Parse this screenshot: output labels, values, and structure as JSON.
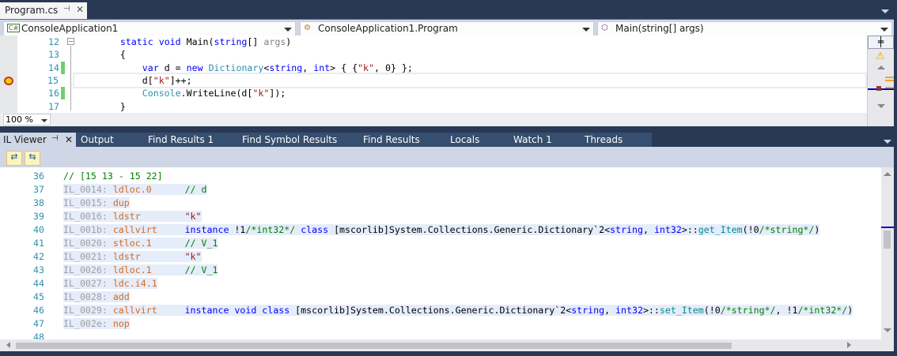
{
  "doc_tab": {
    "title": "Program.cs",
    "pin": "⊣",
    "close": "✕"
  },
  "nav": {
    "project": "ConsoleApplication1",
    "project_icon": "C#",
    "class": "ConsoleApplication1.Program",
    "member": "Main(string[] args)"
  },
  "editor": {
    "zoom": "100 %",
    "current_line": 15,
    "lines": [
      {
        "n": "12",
        "t": [
          [
            "        ",
            "tx"
          ],
          [
            "static",
            "kw"
          ],
          [
            " ",
            "tx"
          ],
          [
            "void",
            "kw"
          ],
          [
            " Main(",
            "tx"
          ],
          [
            "string",
            "kw"
          ],
          [
            "[] ",
            "tx"
          ],
          [
            "args",
            "gr"
          ],
          [
            ")",
            "tx"
          ]
        ]
      },
      {
        "n": "13",
        "t": [
          [
            "        {",
            "tx"
          ]
        ]
      },
      {
        "n": "14",
        "t": [
          [
            "            ",
            "tx"
          ],
          [
            "var",
            "kw"
          ],
          [
            " d = ",
            "tx"
          ],
          [
            "new",
            "kw"
          ],
          [
            " ",
            "tx"
          ],
          [
            "Dictionary",
            "ty"
          ],
          [
            "<",
            "tx"
          ],
          [
            "string",
            "kw"
          ],
          [
            ", ",
            "tx"
          ],
          [
            "int",
            "kw"
          ],
          [
            "> { {",
            "tx"
          ],
          [
            "\"k\"",
            "st"
          ],
          [
            ", 0} };",
            "tx"
          ]
        ]
      },
      {
        "n": "15",
        "t": [
          [
            "            d[",
            "tx"
          ],
          [
            "\"k\"",
            "st"
          ],
          [
            "]++;",
            "tx"
          ]
        ]
      },
      {
        "n": "16",
        "t": [
          [
            "            ",
            "tx"
          ],
          [
            "Console",
            "ty"
          ],
          [
            ".WriteLine(d[",
            "tx"
          ],
          [
            "\"k\"",
            "st"
          ],
          [
            "]);",
            "tx"
          ]
        ]
      },
      {
        "n": "17",
        "t": [
          [
            "        }",
            "tx"
          ]
        ]
      }
    ]
  },
  "tool_tabs": [
    "IL Viewer",
    "Output",
    "Find Results 1",
    "Find Symbol Results",
    "Find Results",
    "Locals",
    "Watch 1",
    "Threads"
  ],
  "il": {
    "lines": [
      {
        "n": "36",
        "t": [
          [
            "// [15 13 - 15 22]",
            "cm"
          ]
        ],
        "hl": false
      },
      {
        "n": "37",
        "t": [
          [
            "IL_0014: ",
            "il"
          ],
          [
            "ldloc.0      ",
            "op"
          ],
          [
            "// d",
            "cm"
          ]
        ],
        "hl": true
      },
      {
        "n": "38",
        "t": [
          [
            "IL_0015: ",
            "il"
          ],
          [
            "dup",
            "op"
          ]
        ],
        "hl": true
      },
      {
        "n": "39",
        "t": [
          [
            "IL_0016: ",
            "il"
          ],
          [
            "ldstr        ",
            "op"
          ],
          [
            "\"k\"",
            "st"
          ]
        ],
        "hl": true
      },
      {
        "n": "40",
        "t": [
          [
            "IL_001b: ",
            "il"
          ],
          [
            "callvirt     ",
            "op"
          ],
          [
            "instance ",
            "kw"
          ],
          [
            "!1",
            "tx"
          ],
          [
            "/*int32*/",
            "cm"
          ],
          [
            " ",
            "tx"
          ],
          [
            "class",
            "kw"
          ],
          [
            " [mscorlib]System.Collections.Generic.Dictionary`2<",
            "tx"
          ],
          [
            "string",
            "kw"
          ],
          [
            ", ",
            "tx"
          ],
          [
            "int32",
            "kw"
          ],
          [
            ">::",
            "tx"
          ],
          [
            "get_Item",
            "fn"
          ],
          [
            "(!0",
            "tx"
          ],
          [
            "/*string*/",
            "cm"
          ],
          [
            ")",
            "tx"
          ]
        ],
        "hl": true
      },
      {
        "n": "41",
        "t": [
          [
            "IL_0020: ",
            "il"
          ],
          [
            "stloc.1      ",
            "op"
          ],
          [
            "// V_1",
            "cm"
          ]
        ],
        "hl": true
      },
      {
        "n": "42",
        "t": [
          [
            "IL_0021: ",
            "il"
          ],
          [
            "ldstr        ",
            "op"
          ],
          [
            "\"k\"",
            "st"
          ]
        ],
        "hl": true
      },
      {
        "n": "43",
        "t": [
          [
            "IL_0026: ",
            "il"
          ],
          [
            "ldloc.1      ",
            "op"
          ],
          [
            "// V_1",
            "cm"
          ]
        ],
        "hl": true
      },
      {
        "n": "44",
        "t": [
          [
            "IL_0027: ",
            "il"
          ],
          [
            "ldc.i4.1",
            "op"
          ]
        ],
        "hl": true
      },
      {
        "n": "45",
        "t": [
          [
            "IL_0028: ",
            "il"
          ],
          [
            "add",
            "op"
          ]
        ],
        "hl": true
      },
      {
        "n": "46",
        "t": [
          [
            "IL_0029: ",
            "il"
          ],
          [
            "callvirt     ",
            "op"
          ],
          [
            "instance void class",
            "kw"
          ],
          [
            " [mscorlib]System.Collections.Generic.Dictionary`2<",
            "tx"
          ],
          [
            "string",
            "kw"
          ],
          [
            ", ",
            "tx"
          ],
          [
            "int32",
            "kw"
          ],
          [
            ">::",
            "tx"
          ],
          [
            "set_Item",
            "fn"
          ],
          [
            "(!0",
            "tx"
          ],
          [
            "/*string*/",
            "cm"
          ],
          [
            ", !1",
            "tx"
          ],
          [
            "/*int32*/",
            "cm"
          ],
          [
            ")",
            "tx"
          ]
        ],
        "hl": true
      },
      {
        "n": "47",
        "t": [
          [
            "IL_002e: ",
            "il"
          ],
          [
            "nop",
            "op"
          ]
        ],
        "hl": true
      },
      {
        "n": "48",
        "t": [],
        "hl": false
      }
    ]
  },
  "colors": {
    "theme": "#293955",
    "accent": "#cfd6e5",
    "highlight": "#e5ecfa"
  }
}
